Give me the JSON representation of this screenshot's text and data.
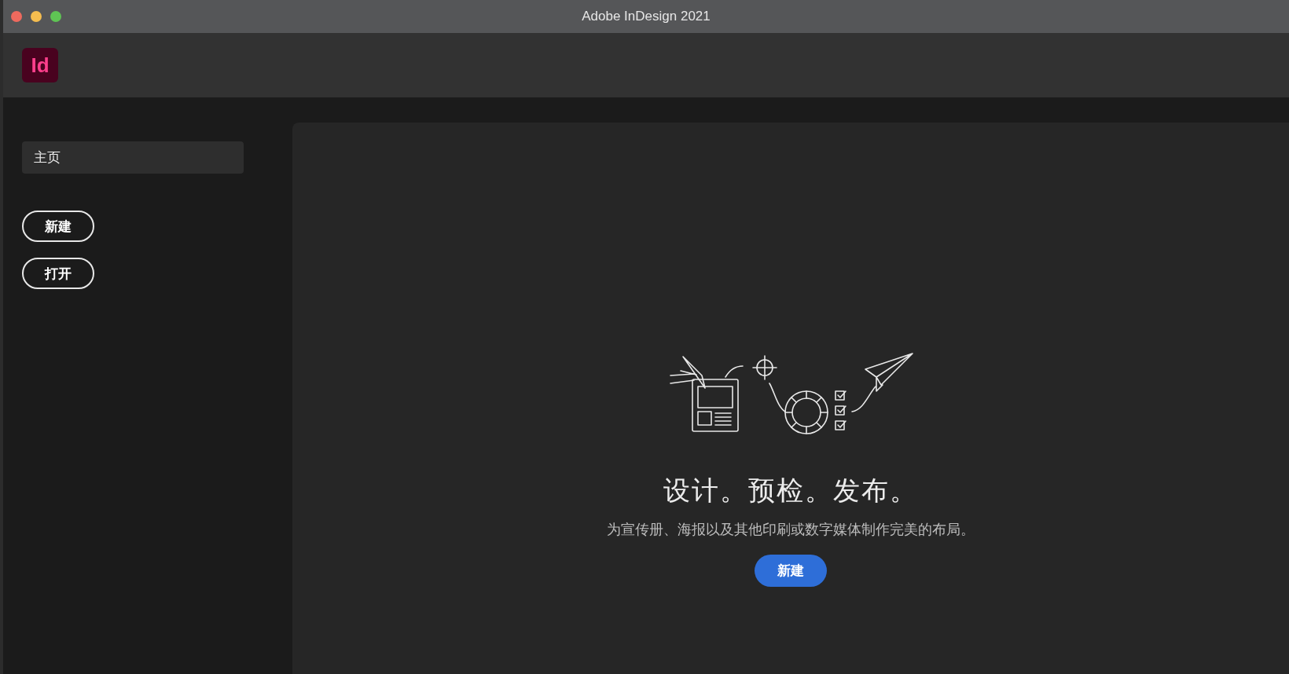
{
  "window": {
    "title": "Adobe InDesign 2021"
  },
  "app_logo": {
    "text": "Id"
  },
  "sidebar": {
    "items": [
      {
        "label": "主页",
        "selected": true
      }
    ],
    "buttons": [
      {
        "label": "新建"
      },
      {
        "label": "打开"
      }
    ]
  },
  "main": {
    "heading": "设计。预检。发布。",
    "description": "为宣传册、海报以及其他印刷或数字媒体制作完美的布局。",
    "button": "新建"
  }
}
